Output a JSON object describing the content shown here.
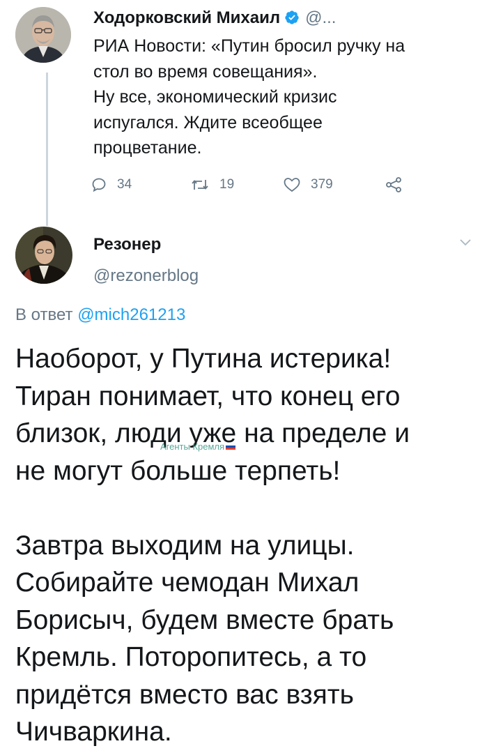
{
  "tweet1": {
    "author_name": "Ходорковский Михаил",
    "author_handle": "@...",
    "verified_icon": "verified-badge-icon",
    "body_lines": [
      "РИА Новости: «Путин бросил ручку на",
      "стол во время совещания».",
      "Ну все, экономический кризис",
      "испугался. Ждите всеобщее",
      "процветание."
    ],
    "actions": {
      "reply_count": "34",
      "retweet_count": "19",
      "like_count": "379"
    }
  },
  "tweet2": {
    "author_name": "Резонер",
    "author_handle": "@rezonerblog",
    "reply_prefix": "В ответ",
    "reply_mention": "@mich261213",
    "body_lines_1": [
      "Наоборот, у Путина истерика!",
      "Тиран понимает, что конец его",
      "близок, люди уже на пределе и",
      "не могут больше терпеть!"
    ],
    "body_lines_2": [
      "Завтра выходим на улицы.",
      "Собирайте чемодан Михал",
      "Борисыч, будем вместе брать",
      "Кремль. Поторопитесь, а то",
      "придётся вместо вас взять",
      "Чичваркина."
    ]
  },
  "watermark": {
    "text": "Агенты Кремля",
    "flag_icon": "russian-flag-icon"
  },
  "colors": {
    "accent": "#1da1f2",
    "secondary_text": "#657786",
    "thread_line": "#ccd6dd"
  }
}
